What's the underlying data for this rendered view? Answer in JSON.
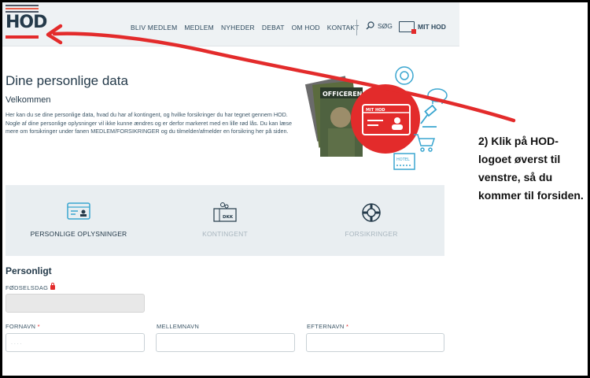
{
  "header": {
    "logo_text": "HOD",
    "nav": [
      "BLIV MEDLEM",
      "MEDLEM",
      "NYHEDER",
      "DEBAT",
      "OM HOD",
      "KONTAKT"
    ],
    "search_label": "SØG",
    "account_label": "MIT HOD"
  },
  "page": {
    "title": "Dine personlige data",
    "subtitle": "Velkommen",
    "intro": "Her kan du se dine personlige data, hvad du har af kontingent, og hvilke forsikringer du har tegnet gennem HOD. Nogle af dine personlige oplysninger vil ikke kunne ændres og er derfor markeret med en lille rød lås. Du kan læse mere om forsikringer under fanen MEDLEM/FORSIKRINGER og du tilmelder/afmelder en forsikring her på siden."
  },
  "illustration": {
    "card_label": "MIT HOD",
    "magazine_title": "OFFICEREN",
    "hotel_label": "HOTEL"
  },
  "tabs": [
    {
      "label": "PERSONLIGE OPLYSNINGER",
      "active": true,
      "icon": "id-card-icon"
    },
    {
      "label": "KONTINGENT",
      "active": false,
      "icon": "money-icon",
      "icon_text": "DKK"
    },
    {
      "label": "FORSIKRINGER",
      "active": false,
      "icon": "lifebuoy-icon"
    }
  ],
  "form": {
    "section_title": "Personligt",
    "birthday_label": "FØDSELSDAG",
    "firstname_label": "FORNAVN",
    "middlename_label": "MELLEMNAVN",
    "lastname_label": "EFTERNAVN",
    "required_mark": "*",
    "firstname_placeholder": ". . . ."
  },
  "annotation": {
    "text": "2) Klik på HOD-logoet øverst til venstre, så du kommer til forsiden."
  },
  "colors": {
    "accent_red": "#e32b2b",
    "navy": "#243a4a",
    "icon_blue": "#3aa6d0",
    "header_bg": "#eef2f4"
  }
}
